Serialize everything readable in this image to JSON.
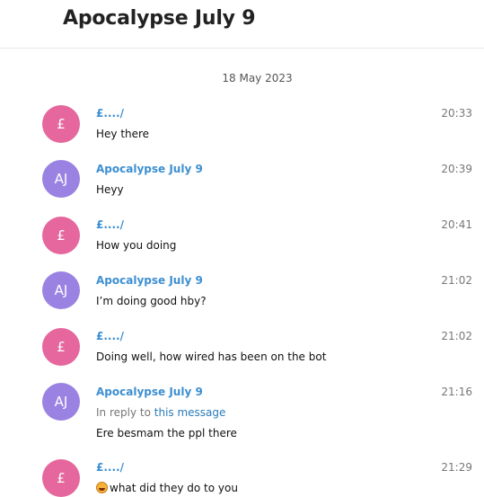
{
  "header": {
    "title": "Apocalypse July 9"
  },
  "date_separator": "18 May 2023",
  "colors": {
    "avatar_pound": "#e5679d",
    "avatar_aj": "#9a82e3",
    "sender_name": "#3d8fd1",
    "link": "#2a7bb8"
  },
  "messages": [
    {
      "avatar": "£",
      "sender": "£..../",
      "time": "20:33",
      "text": "Hey there"
    },
    {
      "avatar": "AJ",
      "sender": "Apocalypse July 9",
      "time": "20:39",
      "text": "Heyy"
    },
    {
      "avatar": "£",
      "sender": "£..../",
      "time": "20:41",
      "text": "How you doing"
    },
    {
      "avatar": "AJ",
      "sender": "Apocalypse July 9",
      "time": "21:02",
      "text": "I’m doing good hby?"
    },
    {
      "avatar": "£",
      "sender": "£..../",
      "time": "21:02",
      "text": "Doing well, how wired has been on the bot"
    },
    {
      "avatar": "AJ",
      "sender": "Apocalypse July 9",
      "time": "21:16",
      "reply_prefix": "In reply to",
      "reply_link": "this message",
      "text": "Ere besmam the ppl there"
    },
    {
      "avatar": "£",
      "sender": "£..../",
      "time": "21:29",
      "emoji": "grinning-face-emoji",
      "text": "what did they do to you"
    }
  ]
}
